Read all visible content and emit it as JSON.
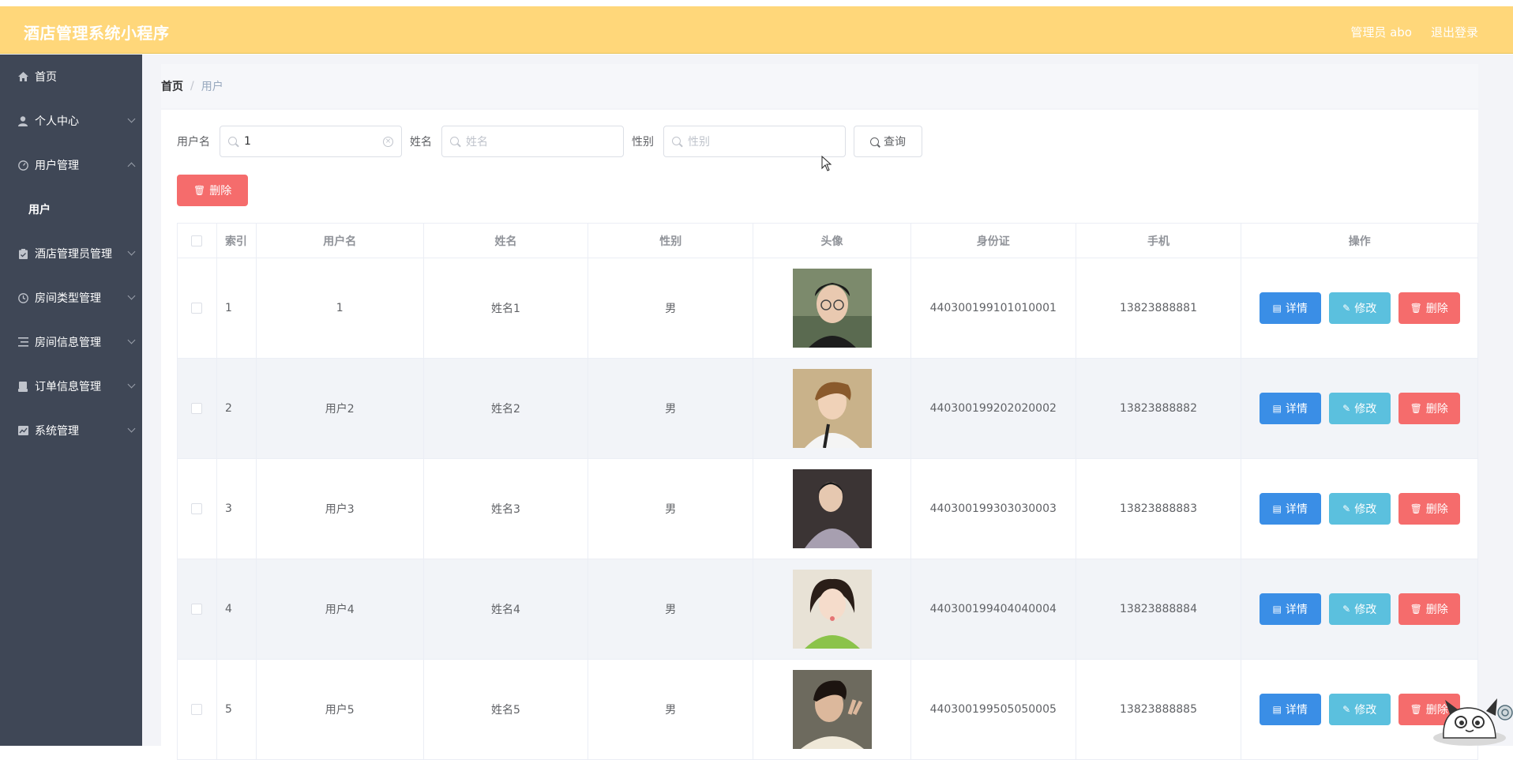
{
  "app": {
    "title": "酒店管理系统小程序"
  },
  "header": {
    "user_label": "管理员 abo",
    "logout_label": "退出登录"
  },
  "sidebar": {
    "items": [
      {
        "label": "首页",
        "icon": "home-icon"
      },
      {
        "label": "个人中心",
        "icon": "user-icon"
      },
      {
        "label": "用户管理",
        "icon": "gauge-icon",
        "expanded": true,
        "sub": "用户"
      },
      {
        "label": "酒店管理员管理",
        "icon": "clipboard-icon"
      },
      {
        "label": "房间类型管理",
        "icon": "clock-icon"
      },
      {
        "label": "房间信息管理",
        "icon": "list-icon"
      },
      {
        "label": "订单信息管理",
        "icon": "printer-icon"
      },
      {
        "label": "系统管理",
        "icon": "chart-icon"
      }
    ]
  },
  "breadcrumb": {
    "home": "首页",
    "sep": "/",
    "current": "用户"
  },
  "search": {
    "username_label": "用户名",
    "username_value": "1",
    "name_label": "姓名",
    "name_placeholder": "姓名",
    "gender_label": "性别",
    "gender_placeholder": "性别",
    "query_label": "查询"
  },
  "actions": {
    "delete_label": "删除"
  },
  "table": {
    "headers": [
      "索引",
      "用户名",
      "姓名",
      "性别",
      "头像",
      "身份证",
      "手机",
      "操作"
    ],
    "rows": [
      {
        "index": "1",
        "username": "1",
        "name": "姓名1",
        "gender": "男",
        "id_card": "440300199101010001",
        "phone": "13823888881"
      },
      {
        "index": "2",
        "username": "用户2",
        "name": "姓名2",
        "gender": "男",
        "id_card": "440300199202020002",
        "phone": "13823888882"
      },
      {
        "index": "3",
        "username": "用户3",
        "name": "姓名3",
        "gender": "男",
        "id_card": "440300199303030003",
        "phone": "13823888883"
      },
      {
        "index": "4",
        "username": "用户4",
        "name": "姓名4",
        "gender": "男",
        "id_card": "440300199404040004",
        "phone": "13823888884"
      },
      {
        "index": "5",
        "username": "用户5",
        "name": "姓名5",
        "gender": "男",
        "id_card": "440300199505050005",
        "phone": "13823888885"
      }
    ],
    "row_actions": {
      "detail": "详情",
      "edit": "修改",
      "delete": "删除"
    }
  },
  "colors": {
    "header": "#ffd77a",
    "sidebar": "#3f4756",
    "primary": "#3a8ee6",
    "info": "#5bc0de",
    "danger": "#f56c6c"
  }
}
